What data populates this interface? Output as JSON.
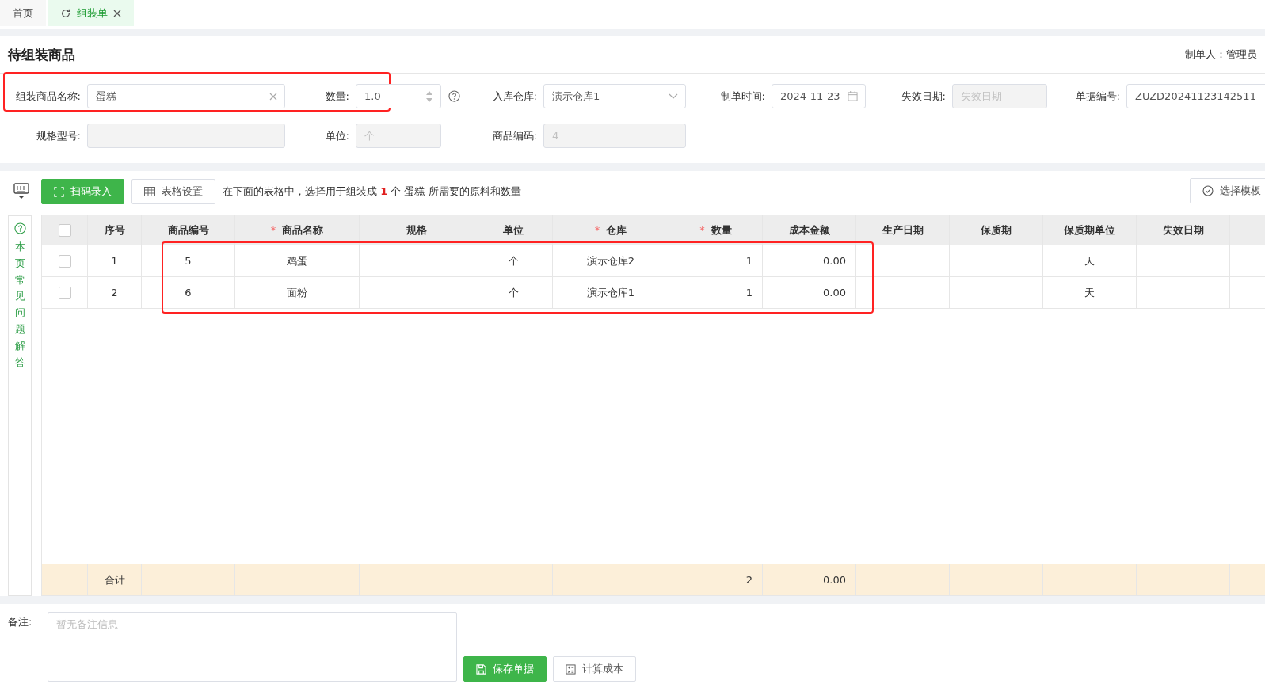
{
  "tabs": [
    {
      "label": "首页",
      "selected": false
    },
    {
      "label": "组装单",
      "selected": true
    }
  ],
  "section_title": "待组装商品",
  "creator": {
    "label": "制单人：",
    "value": "管理员"
  },
  "form": {
    "highlighted": true,
    "rows": [
      [
        {
          "label": "组装商品名称:",
          "kind": "combobox",
          "value": "蛋糕"
        },
        {
          "label": "数量:",
          "kind": "number",
          "value": "1.0"
        },
        {
          "label": "入库仓库:",
          "kind": "select",
          "value": "演示仓库1"
        },
        {
          "label": "制单时间:",
          "kind": "date",
          "value": "2024-11-23"
        },
        {
          "label": "失效日期:",
          "kind": "text",
          "placeholder": "失效日期",
          "disabled": true
        },
        {
          "label": "单据编号:",
          "kind": "text",
          "value": "ZUZD20241123142511",
          "disabled": false
        }
      ],
      [
        {
          "label": "规格型号:",
          "kind": "text",
          "disabled": true
        },
        {
          "label": "单位:",
          "kind": "text",
          "placeholder": "个",
          "disabled": true
        },
        {
          "label": "商品编码:",
          "kind": "text",
          "placeholder": "4",
          "disabled": true
        }
      ]
    ]
  },
  "toolbar": {
    "scan_button": "扫码录入",
    "table_settings_button": "表格设置",
    "hint": "在下面的表格中，选择用于组装成 **1** 个 蛋糕 所需要的原料和数量",
    "template_button": "选择模板"
  },
  "help_panel": {
    "label": "本页常见问题解答"
  },
  "table": {
    "highlighted": true,
    "columns": [
      {
        "label": "序号"
      },
      {
        "label": "商品编号"
      },
      {
        "label": "商品名称",
        "required_mark": "*"
      },
      {
        "label": "规格"
      },
      {
        "label": "单位"
      },
      {
        "label": "仓库",
        "required_mark": "*"
      },
      {
        "label": "数量",
        "required_mark": "*"
      },
      {
        "label": "成本金额"
      },
      {
        "label": "生产日期"
      },
      {
        "label": "保质期"
      },
      {
        "label": "保质期单位"
      },
      {
        "label": "失效日期"
      }
    ],
    "all_checked": false,
    "rows": [
      {
        "checked": false,
        "cells": [
          "1",
          "5",
          "鸡蛋",
          null,
          "个",
          "演示仓库2",
          "1",
          "0.00",
          null,
          null,
          "天",
          null
        ]
      },
      {
        "checked": false,
        "cells": [
          "2",
          "6",
          "面粉",
          null,
          "个",
          "演示仓库1",
          "1",
          "0.00",
          null,
          null,
          "天",
          null
        ]
      }
    ],
    "footer": {
      "label": "合计",
      "quantity_total": "2",
      "cost_total": "0.00"
    }
  },
  "remark": {
    "label": "备注:",
    "placeholder": "暂无备注信息"
  },
  "actions": {
    "save_button": "保存单据",
    "calculate_button": "计算成本"
  }
}
